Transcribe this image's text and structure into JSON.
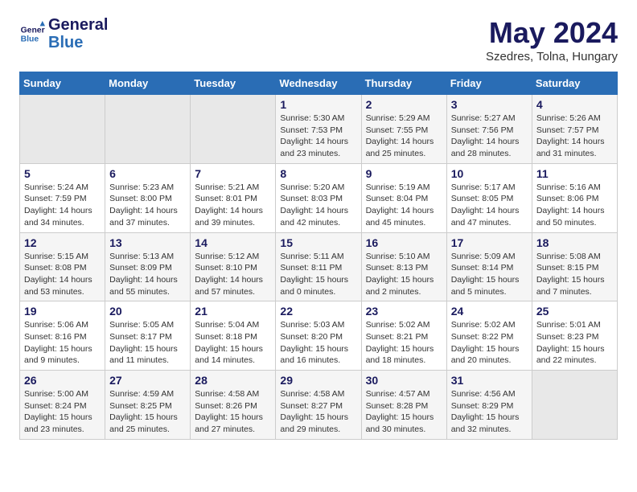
{
  "header": {
    "logo_line1": "General",
    "logo_line2": "Blue",
    "month_title": "May 2024",
    "location": "Szedres, Tolna, Hungary"
  },
  "weekdays": [
    "Sunday",
    "Monday",
    "Tuesday",
    "Wednesday",
    "Thursday",
    "Friday",
    "Saturday"
  ],
  "weeks": [
    [
      {
        "day": "",
        "text": ""
      },
      {
        "day": "",
        "text": ""
      },
      {
        "day": "",
        "text": ""
      },
      {
        "day": "1",
        "text": "Sunrise: 5:30 AM\nSunset: 7:53 PM\nDaylight: 14 hours\nand 23 minutes."
      },
      {
        "day": "2",
        "text": "Sunrise: 5:29 AM\nSunset: 7:55 PM\nDaylight: 14 hours\nand 25 minutes."
      },
      {
        "day": "3",
        "text": "Sunrise: 5:27 AM\nSunset: 7:56 PM\nDaylight: 14 hours\nand 28 minutes."
      },
      {
        "day": "4",
        "text": "Sunrise: 5:26 AM\nSunset: 7:57 PM\nDaylight: 14 hours\nand 31 minutes."
      }
    ],
    [
      {
        "day": "5",
        "text": "Sunrise: 5:24 AM\nSunset: 7:59 PM\nDaylight: 14 hours\nand 34 minutes."
      },
      {
        "day": "6",
        "text": "Sunrise: 5:23 AM\nSunset: 8:00 PM\nDaylight: 14 hours\nand 37 minutes."
      },
      {
        "day": "7",
        "text": "Sunrise: 5:21 AM\nSunset: 8:01 PM\nDaylight: 14 hours\nand 39 minutes."
      },
      {
        "day": "8",
        "text": "Sunrise: 5:20 AM\nSunset: 8:03 PM\nDaylight: 14 hours\nand 42 minutes."
      },
      {
        "day": "9",
        "text": "Sunrise: 5:19 AM\nSunset: 8:04 PM\nDaylight: 14 hours\nand 45 minutes."
      },
      {
        "day": "10",
        "text": "Sunrise: 5:17 AM\nSunset: 8:05 PM\nDaylight: 14 hours\nand 47 minutes."
      },
      {
        "day": "11",
        "text": "Sunrise: 5:16 AM\nSunset: 8:06 PM\nDaylight: 14 hours\nand 50 minutes."
      }
    ],
    [
      {
        "day": "12",
        "text": "Sunrise: 5:15 AM\nSunset: 8:08 PM\nDaylight: 14 hours\nand 53 minutes."
      },
      {
        "day": "13",
        "text": "Sunrise: 5:13 AM\nSunset: 8:09 PM\nDaylight: 14 hours\nand 55 minutes."
      },
      {
        "day": "14",
        "text": "Sunrise: 5:12 AM\nSunset: 8:10 PM\nDaylight: 14 hours\nand 57 minutes."
      },
      {
        "day": "15",
        "text": "Sunrise: 5:11 AM\nSunset: 8:11 PM\nDaylight: 15 hours\nand 0 minutes."
      },
      {
        "day": "16",
        "text": "Sunrise: 5:10 AM\nSunset: 8:13 PM\nDaylight: 15 hours\nand 2 minutes."
      },
      {
        "day": "17",
        "text": "Sunrise: 5:09 AM\nSunset: 8:14 PM\nDaylight: 15 hours\nand 5 minutes."
      },
      {
        "day": "18",
        "text": "Sunrise: 5:08 AM\nSunset: 8:15 PM\nDaylight: 15 hours\nand 7 minutes."
      }
    ],
    [
      {
        "day": "19",
        "text": "Sunrise: 5:06 AM\nSunset: 8:16 PM\nDaylight: 15 hours\nand 9 minutes."
      },
      {
        "day": "20",
        "text": "Sunrise: 5:05 AM\nSunset: 8:17 PM\nDaylight: 15 hours\nand 11 minutes."
      },
      {
        "day": "21",
        "text": "Sunrise: 5:04 AM\nSunset: 8:18 PM\nDaylight: 15 hours\nand 14 minutes."
      },
      {
        "day": "22",
        "text": "Sunrise: 5:03 AM\nSunset: 8:20 PM\nDaylight: 15 hours\nand 16 minutes."
      },
      {
        "day": "23",
        "text": "Sunrise: 5:02 AM\nSunset: 8:21 PM\nDaylight: 15 hours\nand 18 minutes."
      },
      {
        "day": "24",
        "text": "Sunrise: 5:02 AM\nSunset: 8:22 PM\nDaylight: 15 hours\nand 20 minutes."
      },
      {
        "day": "25",
        "text": "Sunrise: 5:01 AM\nSunset: 8:23 PM\nDaylight: 15 hours\nand 22 minutes."
      }
    ],
    [
      {
        "day": "26",
        "text": "Sunrise: 5:00 AM\nSunset: 8:24 PM\nDaylight: 15 hours\nand 23 minutes."
      },
      {
        "day": "27",
        "text": "Sunrise: 4:59 AM\nSunset: 8:25 PM\nDaylight: 15 hours\nand 25 minutes."
      },
      {
        "day": "28",
        "text": "Sunrise: 4:58 AM\nSunset: 8:26 PM\nDaylight: 15 hours\nand 27 minutes."
      },
      {
        "day": "29",
        "text": "Sunrise: 4:58 AM\nSunset: 8:27 PM\nDaylight: 15 hours\nand 29 minutes."
      },
      {
        "day": "30",
        "text": "Sunrise: 4:57 AM\nSunset: 8:28 PM\nDaylight: 15 hours\nand 30 minutes."
      },
      {
        "day": "31",
        "text": "Sunrise: 4:56 AM\nSunset: 8:29 PM\nDaylight: 15 hours\nand 32 minutes."
      },
      {
        "day": "",
        "text": ""
      }
    ]
  ]
}
